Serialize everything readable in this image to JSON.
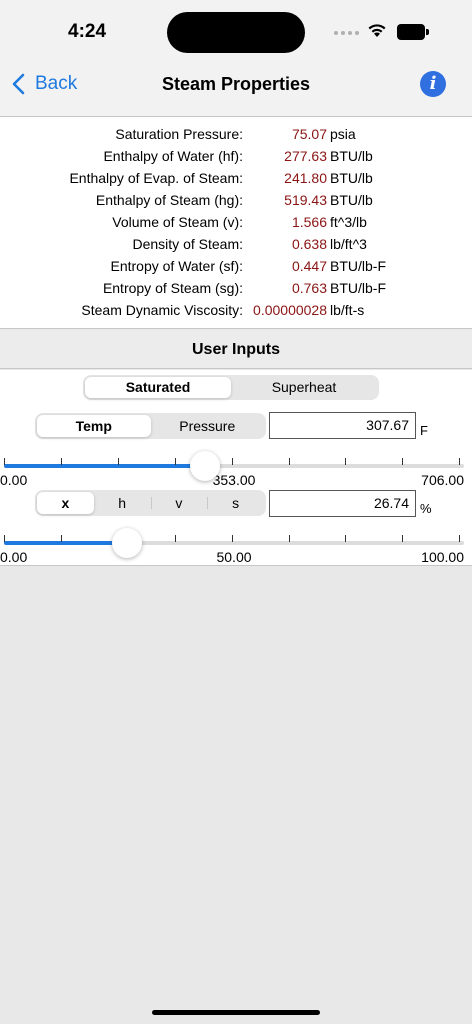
{
  "status": {
    "time": "4:24",
    "signal_dots_icon": "signal-dots-icon",
    "wifi_icon": "wifi-icon",
    "battery_icon": "battery-icon"
  },
  "nav": {
    "back_label": "Back",
    "title": "Steam Properties",
    "info_label": "i"
  },
  "results": [
    {
      "label": "Saturation Pressure:",
      "value": "75.07",
      "unit": "psia"
    },
    {
      "label": "Enthalpy of Water (hf):",
      "value": "277.63",
      "unit": "BTU/lb"
    },
    {
      "label": "Enthalpy of Evap. of Steam:",
      "value": "241.80",
      "unit": "BTU/lb"
    },
    {
      "label": "Enthalpy of Steam (hg):",
      "value": "519.43",
      "unit": "BTU/lb"
    },
    {
      "label": "Volume of Steam (v):",
      "value": "1.566",
      "unit": "ft^3/lb"
    },
    {
      "label": "Density of Steam:",
      "value": "0.638",
      "unit": "lb/ft^3"
    },
    {
      "label": "Entropy of Water (sf):",
      "value": "0.447",
      "unit": "BTU/lb-F"
    },
    {
      "label": "Entropy of Steam (sg):",
      "value": "0.763",
      "unit": "BTU/lb-F"
    },
    {
      "label": "Steam Dynamic Viscosity:",
      "value": "0.00000028",
      "unit": "lb/ft-s"
    }
  ],
  "inputs": {
    "header": "User Inputs",
    "state_segment": {
      "options": [
        "Saturated",
        "Superheat"
      ],
      "selected": 0
    },
    "basis_segment": {
      "options": [
        "Temp",
        "Pressure"
      ],
      "selected": 0
    },
    "basis_value": "307.67",
    "basis_unit": "F",
    "basis_slider": {
      "min_label": "0.00",
      "mid_label": "353.00",
      "max_label": "706.00",
      "fraction": 0.436
    },
    "quality_segment": {
      "options": [
        "x",
        "h",
        "v",
        "s"
      ],
      "selected": 0
    },
    "quality_value": "26.74",
    "quality_unit": "%",
    "quality_slider": {
      "min_label": "0.00",
      "mid_label": "50.00",
      "max_label": "100.00",
      "fraction": 0.2674
    }
  },
  "colors": {
    "accent": "#1f7ae0",
    "value_text": "#8b1414",
    "info_button": "#2f6fe0"
  }
}
